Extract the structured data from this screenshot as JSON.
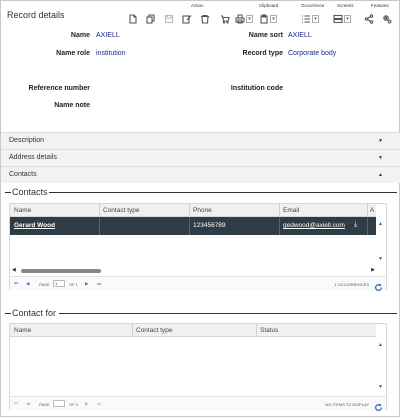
{
  "header": {
    "title": "Record details",
    "groups": {
      "action": "Action",
      "clipboard": "Clipboard",
      "occurrence": "Occurrence",
      "screens": "Screens",
      "features": "Features"
    }
  },
  "fields": {
    "name_label": "Name",
    "name_value": "AXIELL",
    "name_sort_label": "Name sort",
    "name_sort_value": "AXIELL",
    "name_role_label": "Name role",
    "name_role_value": "institution",
    "record_type_label": "Record type",
    "record_type_value": "Corporate body",
    "reference_number_label": "Reference number",
    "institution_code_label": "Institution code",
    "name_note_label": "Name note"
  },
  "sections": {
    "description": "Description",
    "address_details": "Address details",
    "contacts": "Contacts"
  },
  "contacts_grid": {
    "heading": "Contacts",
    "columns": [
      "Name",
      "Contact type",
      "Phone",
      "Email",
      "A"
    ],
    "rows": [
      {
        "name": "Gerard Wood",
        "contact_type": "",
        "phone": "123456789",
        "email": "gedwood@axiell.com"
      }
    ],
    "pager": {
      "page_label": "PAGE",
      "page_value": "1",
      "of_label": "OF 1",
      "info": "1 OCCURRENCES"
    }
  },
  "contact_for_grid": {
    "heading": "Contact for",
    "columns": [
      "Name",
      "Contact type",
      "Status"
    ],
    "pager": {
      "page_label": "PAGE",
      "page_value": "",
      "of_label": "OF 0",
      "info": "NO ITEMS TO DISPLAY"
    }
  },
  "colors": {
    "value_text": "#1a2d8a",
    "selected_row": "#2e3d45",
    "pager_accent": "#3a6fbf"
  }
}
